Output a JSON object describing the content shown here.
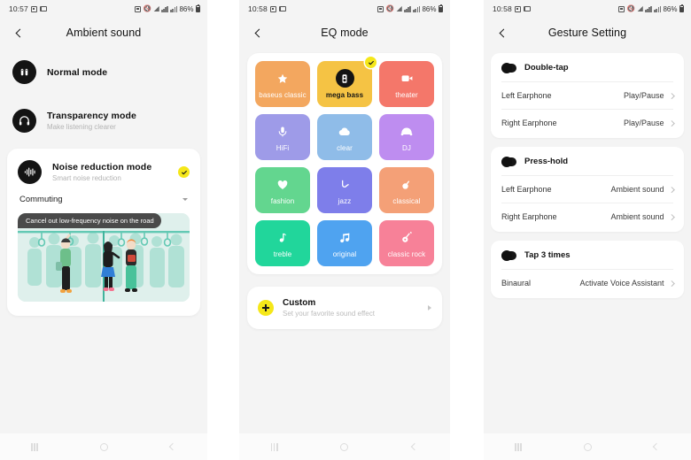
{
  "status_bar": {
    "time_1": "10:57",
    "time_2": "10:58",
    "time_3": "10:58",
    "battery": "86%",
    "icons": [
      "gallery-icon",
      "mute-icon",
      "wifi-icon",
      "signal-icon",
      "signal-icon",
      "battery-icon"
    ]
  },
  "screen_ambient": {
    "title": "Ambient sound",
    "modes": [
      {
        "title": "Normal mode",
        "subtitle": "",
        "icon": "earbuds-icon",
        "selected": false
      },
      {
        "title": "Transparency mode",
        "subtitle": "Make listening clearer",
        "icon": "headphones-icon",
        "selected": false
      },
      {
        "title": "Noise reduction mode",
        "subtitle": "Smart noise reduction",
        "icon": "soundwave-icon",
        "selected": true
      }
    ],
    "dropdown_value": "Commuting",
    "illustration_caption": "Cancel out low-frequency noise on the road",
    "accent_color": "#F5E719",
    "illustration_bg": "#dff0ec"
  },
  "screen_eq": {
    "title": "EQ mode",
    "tiles": [
      {
        "label": "baseus classic",
        "color": "#F3A75F",
        "icon": "star-icon",
        "selected": false
      },
      {
        "label": "mega bass",
        "color": "#F5C344",
        "icon": "speaker-icon",
        "selected": true
      },
      {
        "label": "theater",
        "color": "#F4776A",
        "icon": "video-camera-icon",
        "selected": false
      },
      {
        "label": "HiFi",
        "color": "#9E9BE8",
        "icon": "microphone-icon",
        "selected": false
      },
      {
        "label": "clear",
        "color": "#8FBCE8",
        "icon": "cloud-icon",
        "selected": false
      },
      {
        "label": "DJ",
        "color": "#BE8DF0",
        "icon": "dj-headset-icon",
        "selected": false
      },
      {
        "label": "fashion",
        "color": "#63D68F",
        "icon": "heart-icon",
        "selected": false
      },
      {
        "label": "jazz",
        "color": "#7E7EEA",
        "icon": "saxophone-icon",
        "selected": false
      },
      {
        "label": "classical",
        "color": "#F4A077",
        "icon": "banjo-icon",
        "selected": false
      },
      {
        "label": "treble",
        "color": "#21D69B",
        "icon": "single-note-icon",
        "selected": false
      },
      {
        "label": "original",
        "color": "#4FA3F0",
        "icon": "double-note-icon",
        "selected": false
      },
      {
        "label": "classic rock",
        "color": "#F78198",
        "icon": "guitar-icon",
        "selected": false
      }
    ],
    "custom": {
      "title": "Custom",
      "subtitle": "Set your favorite sound effect",
      "icon": "plus-icon"
    }
  },
  "screen_gesture": {
    "title": "Gesture Setting",
    "groups": [
      {
        "header": "Double-tap",
        "rows": [
          {
            "label": "Left Earphone",
            "value": "Play/Pause"
          },
          {
            "label": "Right Earphone",
            "value": "Play/Pause"
          }
        ]
      },
      {
        "header": "Press-hold",
        "rows": [
          {
            "label": "Left Earphone",
            "value": "Ambient sound"
          },
          {
            "label": "Right Earphone",
            "value": "Ambient sound"
          }
        ]
      },
      {
        "header": "Tap 3 times",
        "rows": [
          {
            "label": "Binaural",
            "value": "Activate Voice Assistant"
          }
        ]
      }
    ]
  },
  "navbar": {
    "recents": "recents-icon",
    "home": "home-icon",
    "back": "back-icon"
  }
}
